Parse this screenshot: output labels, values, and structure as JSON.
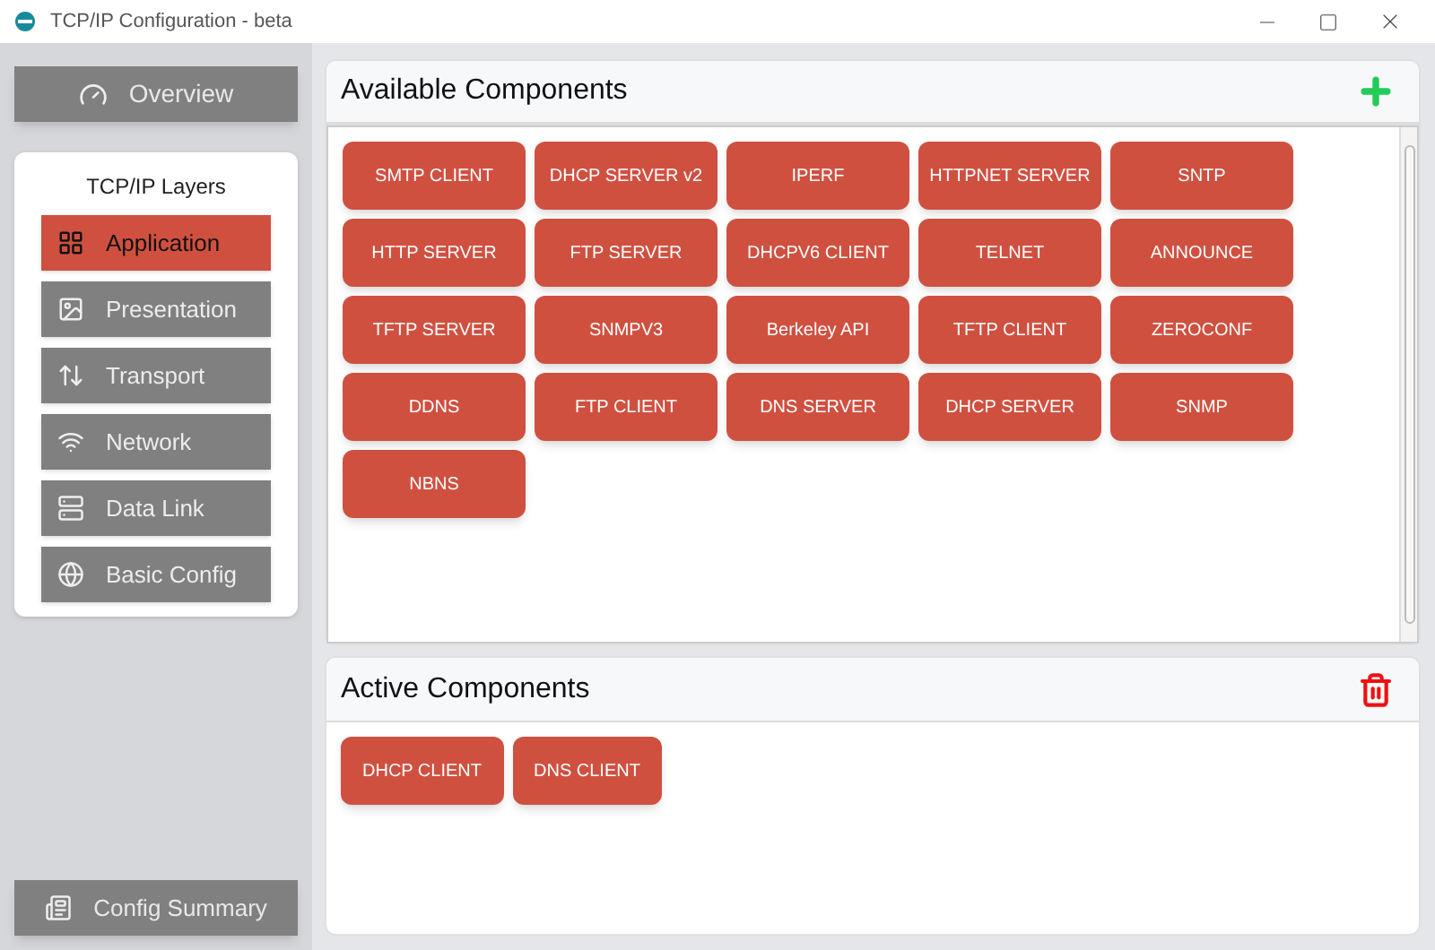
{
  "window": {
    "title": "TCP/IP Configuration - beta"
  },
  "sidebar": {
    "overview": "Overview",
    "layers_title": "TCP/IP Layers",
    "layers": [
      {
        "label": "Application",
        "kind": "application",
        "selected": true
      },
      {
        "label": "Presentation",
        "kind": "presentation",
        "selected": false
      },
      {
        "label": "Transport",
        "kind": "transport",
        "selected": false
      },
      {
        "label": "Network",
        "kind": "network",
        "selected": false
      },
      {
        "label": "Data Link",
        "kind": "datalink",
        "selected": false
      },
      {
        "label": "Basic Config",
        "kind": "basic",
        "selected": false
      }
    ],
    "config_summary": "Config Summary"
  },
  "available": {
    "title": "Available Components",
    "components": [
      "SMTP CLIENT",
      "DHCP SERVER v2",
      "IPERF",
      "HTTPNET SERVER",
      "SNTP",
      "HTTP SERVER",
      "FTP SERVER",
      "DHCPV6 CLIENT",
      "TELNET",
      "ANNOUNCE",
      "TFTP SERVER",
      "SNMPV3",
      "Berkeley API",
      "TFTP CLIENT",
      "ZEROCONF",
      "DDNS",
      "FTP CLIENT",
      "DNS SERVER",
      "DHCP SERVER",
      "SNMP",
      "NBNS"
    ]
  },
  "active": {
    "title": "Active Components",
    "components": [
      "DHCP CLIENT",
      "DNS CLIENT"
    ]
  }
}
